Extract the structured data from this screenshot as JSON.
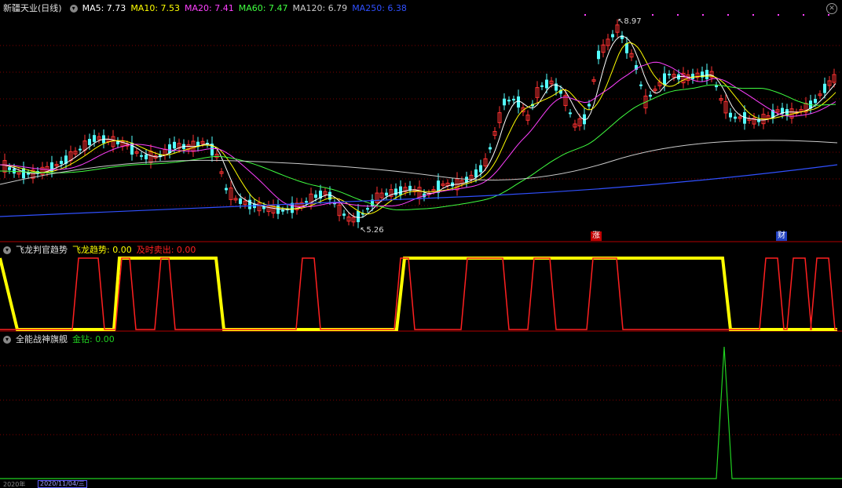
{
  "header": {
    "stock_name": "新疆天业(日线)",
    "ma_items": [
      {
        "label": "MA5: 7.73",
        "color": "#ffffff"
      },
      {
        "label": "MA10: 7.53",
        "color": "#ffff00"
      },
      {
        "label": "MA20: 7.41",
        "color": "#ff40ff"
      },
      {
        "label": "MA60: 7.47",
        "color": "#40ff40"
      },
      {
        "label": "MA120: 6.79",
        "color": "#cccccc"
      },
      {
        "label": "MA250: 6.38",
        "color": "#3050ff"
      }
    ]
  },
  "main_chart": {
    "high_label": "8.97",
    "low_label": "5.26",
    "badge_zhang": "涨",
    "badge_cai": "财"
  },
  "panel2": {
    "title": "飞龙判官趋势",
    "trend_label": "飞龙趋势: 0.00",
    "sell_label": "及时卖出: 0.00"
  },
  "panel3": {
    "title": "全能战神旗舰",
    "diamond_label": "金钻: 0.00"
  },
  "bottom_axis": {
    "year_label": "2020年",
    "date_label": "2020/11/04/三"
  },
  "colors": {
    "up": "#ff3232",
    "down": "#54ffff",
    "trend": "#ffff00",
    "sell": "#ff2020",
    "diamond": "#20d020",
    "grid": "#800000"
  }
}
